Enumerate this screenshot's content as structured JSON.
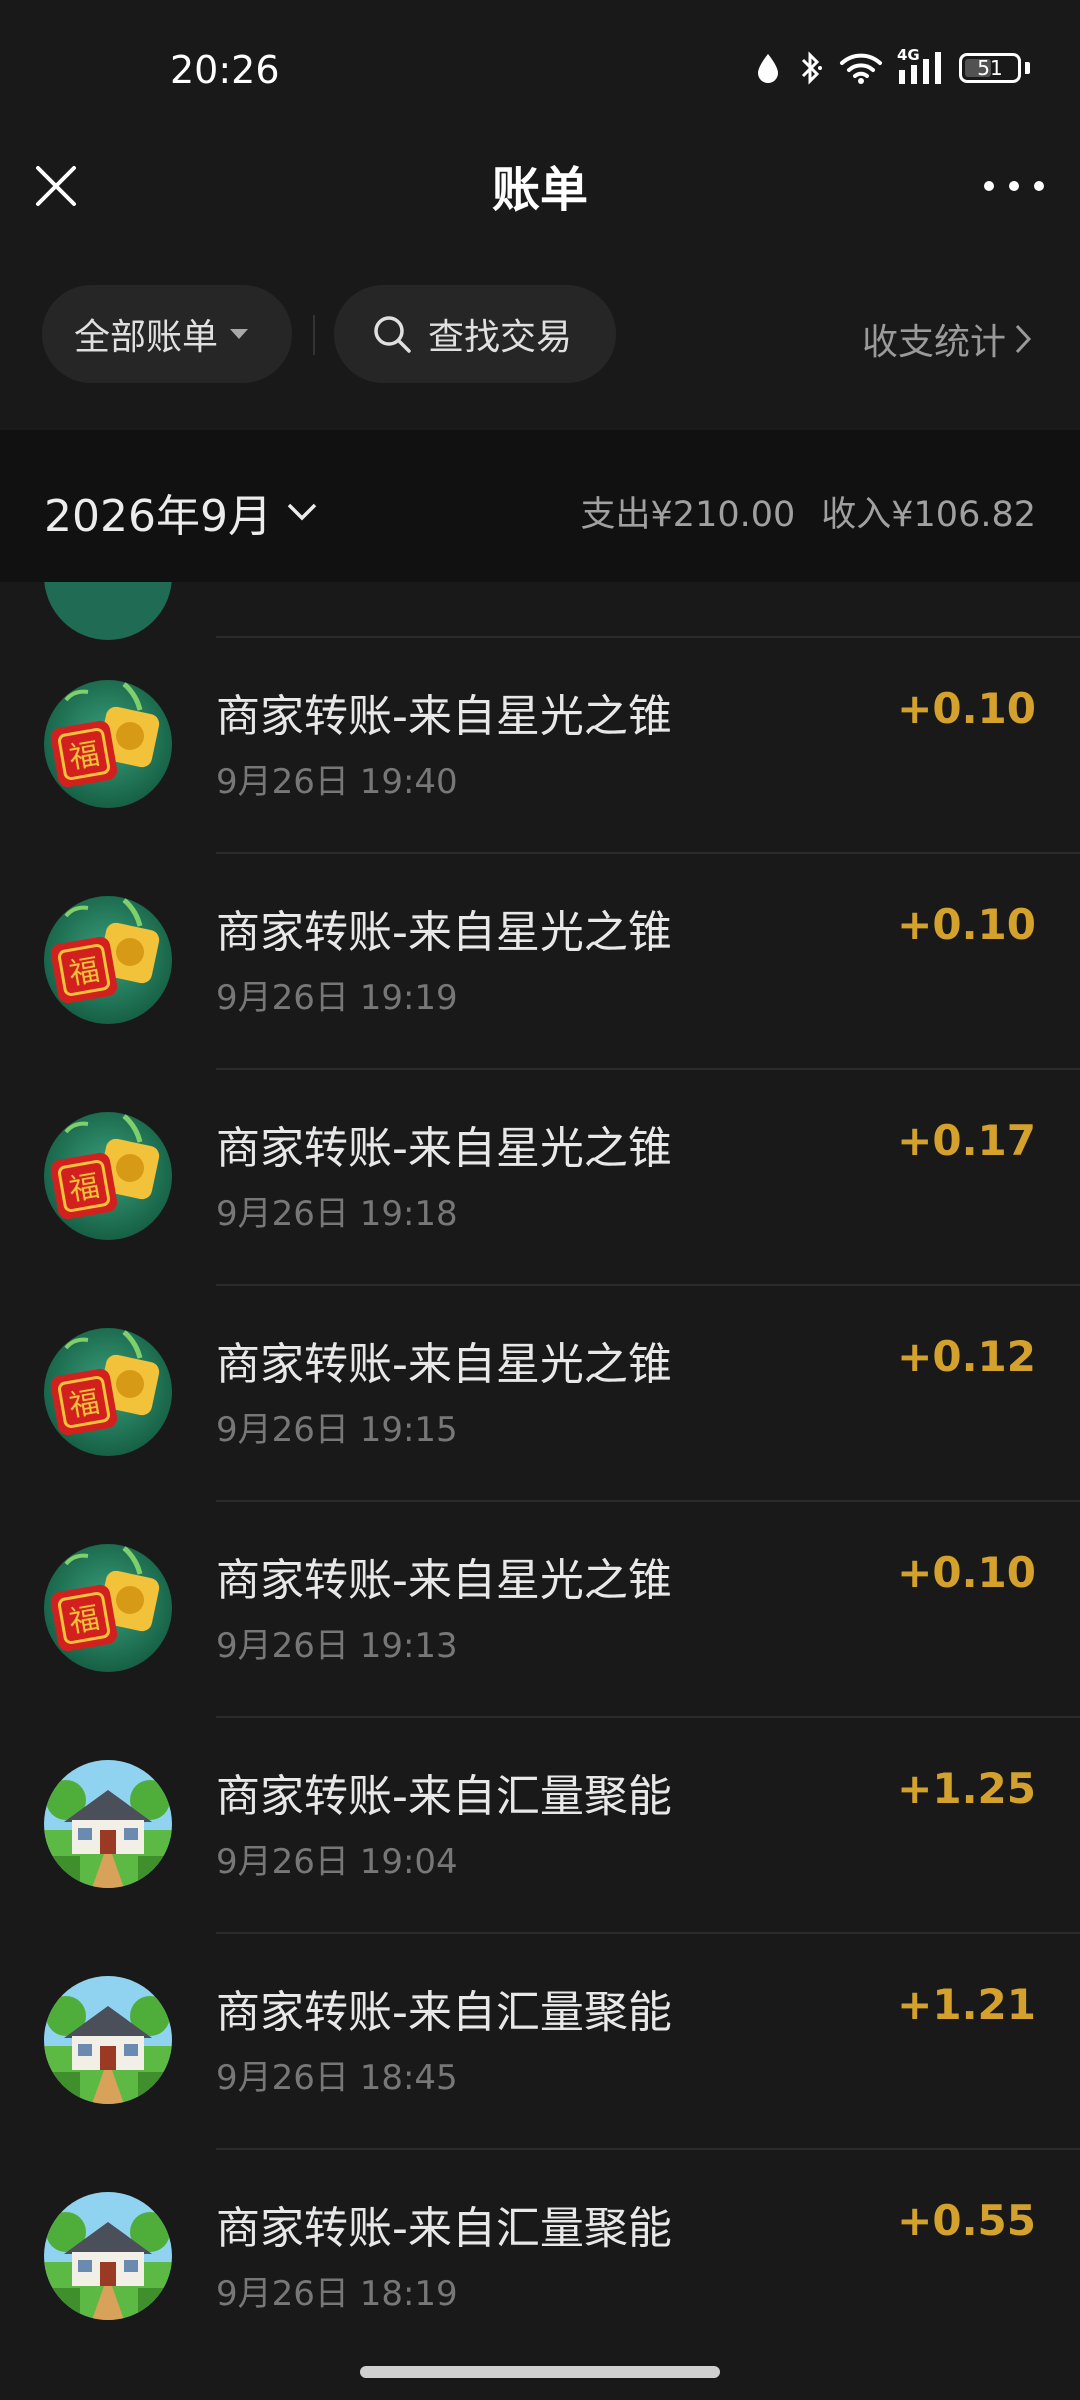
{
  "status_bar": {
    "time": "20:26",
    "network": "4G",
    "battery": "51",
    "battery_level": 0.51
  },
  "nav": {
    "title": "账单"
  },
  "filter": {
    "all_bills_label": "全部账单",
    "search_label": "查找交易",
    "stats_label": "收支统计"
  },
  "month": {
    "label": "2026年9月",
    "expense": "支出¥210.00",
    "income": "收入¥106.82"
  },
  "transactions": [
    {
      "title": "商家转账-来自星光之锥",
      "time": "9月26日 19:40",
      "amount": "+0.10",
      "avatar": "fortune-game-icon"
    },
    {
      "title": "商家转账-来自星光之锥",
      "time": "9月26日 19:19",
      "amount": "+0.10",
      "avatar": "fortune-game-icon"
    },
    {
      "title": "商家转账-来自星光之锥",
      "time": "9月26日 19:18",
      "amount": "+0.17",
      "avatar": "fortune-game-icon"
    },
    {
      "title": "商家转账-来自星光之锥",
      "time": "9月26日 19:15",
      "amount": "+0.12",
      "avatar": "fortune-game-icon"
    },
    {
      "title": "商家转账-来自星光之锥",
      "time": "9月26日 19:13",
      "amount": "+0.10",
      "avatar": "fortune-game-icon"
    },
    {
      "title": "商家转账-来自汇量聚能",
      "time": "9月26日 19:04",
      "amount": "+1.25",
      "avatar": "farmhouse-icon"
    },
    {
      "title": "商家转账-来自汇量聚能",
      "time": "9月26日 18:45",
      "amount": "+1.21",
      "avatar": "farmhouse-icon"
    },
    {
      "title": "商家转账-来自汇量聚能",
      "time": "9月26日 18:19",
      "amount": "+0.55",
      "avatar": "farmhouse-icon"
    }
  ],
  "colors": {
    "background": "#191919",
    "amount_income": "#d4a22c",
    "month_header": "#111111"
  }
}
